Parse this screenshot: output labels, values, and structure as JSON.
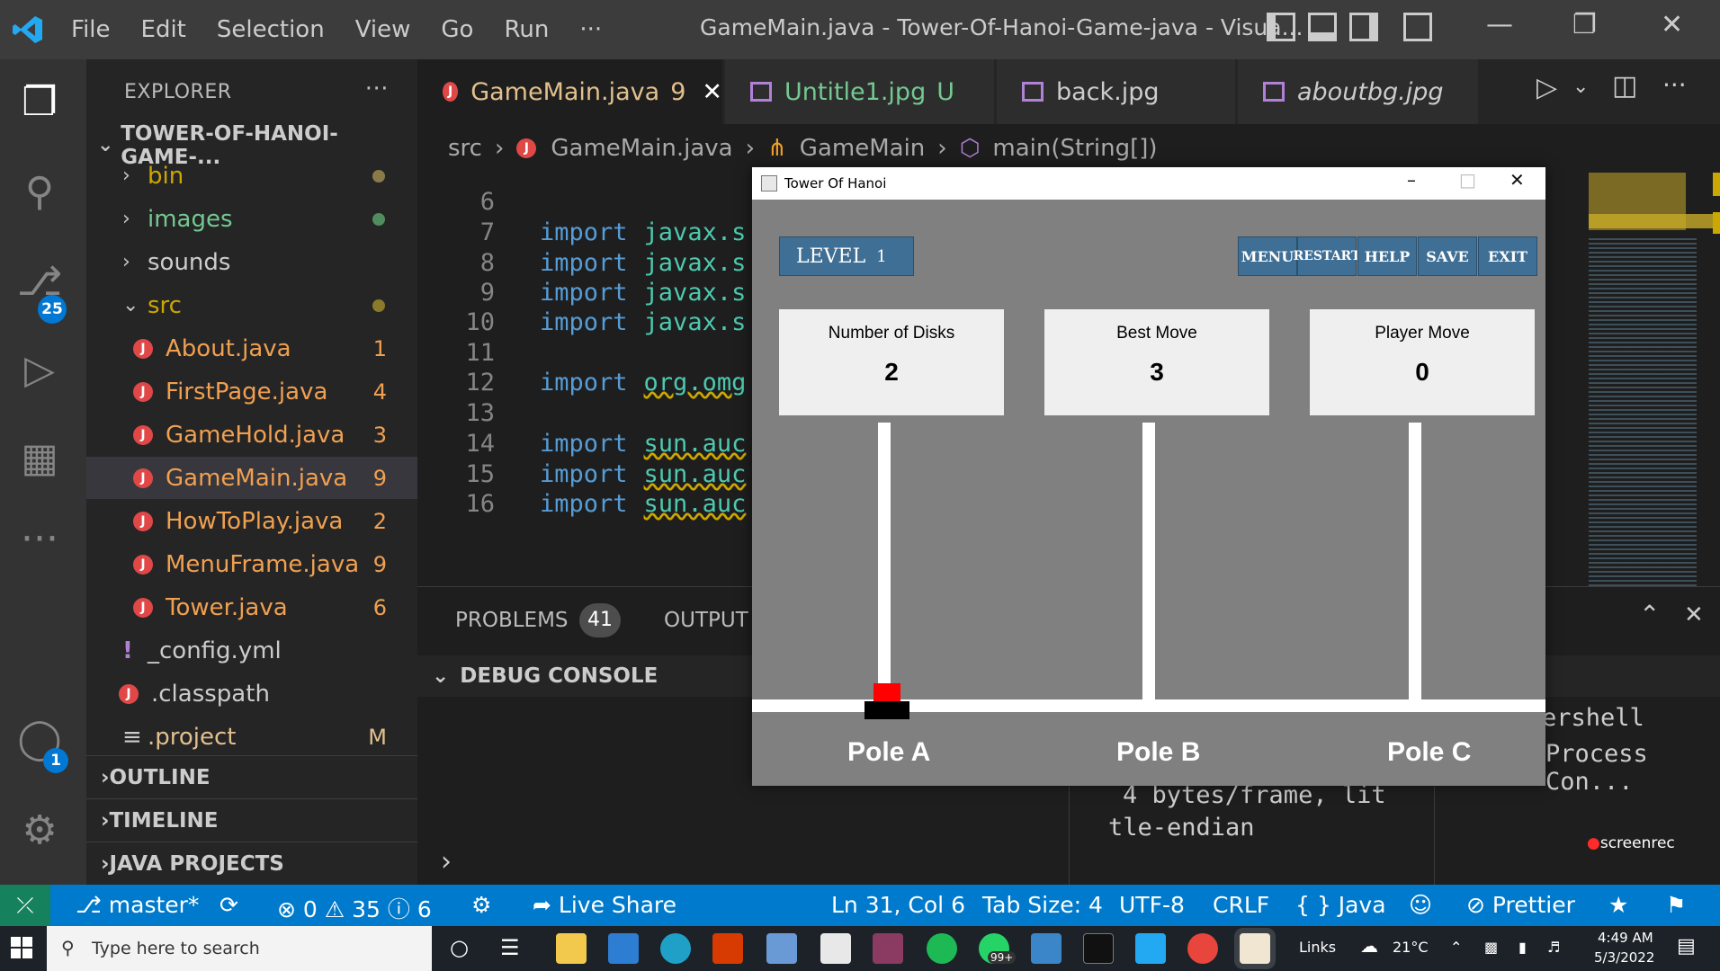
{
  "titlebar": {
    "menus": [
      "File",
      "Edit",
      "Selection",
      "View",
      "Go",
      "Run",
      "···"
    ],
    "window_title": "GameMain.java - Tower-Of-Hanoi-Game-java - Visua..."
  },
  "activitybar": {
    "scm_badge": "25",
    "accounts_badge": "1"
  },
  "sidebar": {
    "title": "EXPLORER",
    "project": "TOWER-OF-HANOI-GAME-...",
    "items": [
      {
        "label": "bin",
        "type": "folder"
      },
      {
        "label": "images",
        "type": "folder"
      },
      {
        "label": "sounds",
        "type": "folder"
      },
      {
        "label": "src",
        "type": "folder-open"
      },
      {
        "label": "About.java",
        "count": "1"
      },
      {
        "label": "FirstPage.java",
        "count": "4"
      },
      {
        "label": "GameHold.java",
        "count": "3"
      },
      {
        "label": "GameMain.java",
        "count": "9"
      },
      {
        "label": "HowToPlay.java",
        "count": "2"
      },
      {
        "label": "MenuFrame.java",
        "count": "9"
      },
      {
        "label": "Tower.java",
        "count": "6"
      },
      {
        "label": "_config.yml"
      },
      {
        "label": ".classpath"
      },
      {
        "label": ".project",
        "count": "M"
      }
    ],
    "sections": [
      "OUTLINE",
      "TIMELINE",
      "JAVA PROJECTS"
    ]
  },
  "tabs": [
    {
      "label": "GameMain.java",
      "badge": "9"
    },
    {
      "label": "Untitle1.jpg",
      "badge": "U"
    },
    {
      "label": "back.jpg"
    },
    {
      "label": "aboutbg.jpg"
    }
  ],
  "breadcrumb": [
    "src",
    "GameMain.java",
    "GameMain",
    "main(String[])"
  ],
  "code": [
    {
      "ln": "6",
      "kw": "",
      "pk": ""
    },
    {
      "ln": "7",
      "kw": "import",
      "pk": "javax.s"
    },
    {
      "ln": "8",
      "kw": "import",
      "pk": "javax.s"
    },
    {
      "ln": "9",
      "kw": "import",
      "pk": "javax.s"
    },
    {
      "ln": "10",
      "kw": "import",
      "pk": "javax.s"
    },
    {
      "ln": "11",
      "kw": "",
      "pk": ""
    },
    {
      "ln": "12",
      "kw": "import",
      "pk": "org.omg"
    },
    {
      "ln": "13",
      "kw": "",
      "pk": ""
    },
    {
      "ln": "14",
      "kw": "import",
      "pk": "sun.auc"
    },
    {
      "ln": "15",
      "kw": "import",
      "pk": "sun.auc"
    },
    {
      "ln": "16",
      "kw": "import",
      "pk": "sun.auc"
    }
  ],
  "panel": {
    "problems": "PROBLEMS",
    "problems_count": "41",
    "output": "OUTPUT",
    "debug_console": "DEBUG CONSOLE",
    "term_right_1": "ershell",
    "term_right_2": "Process Con...",
    "term_mid_1": "4 bytes/frame, lit",
    "term_mid_2": "tle-endian"
  },
  "statusbar": {
    "branch": "master*",
    "errors": "0",
    "warnings": "35",
    "infos": "6",
    "live_share": "Live Share",
    "position": "Ln 31, Col 6",
    "tab_size": "Tab Size: 4",
    "encoding": "UTF-8",
    "eol": "CRLF",
    "language": "Java",
    "prettier": "Prettier"
  },
  "taskbar": {
    "search_placeholder": "Type here to search",
    "links": "Links",
    "temperature": "21°C",
    "time": "4:49 AM",
    "date": "5/3/2022",
    "whatsapp_badge": "99+"
  },
  "game": {
    "title": "Tower Of Hanoi",
    "level_label": "LEVEL",
    "level": "1",
    "buttons": [
      "MENU",
      "RESTART",
      "HELP",
      "SAVE",
      "EXIT"
    ],
    "stats": [
      {
        "label": "Number of Disks",
        "value": "2"
      },
      {
        "label": "Best Move",
        "value": "3"
      },
      {
        "label": "Player Move",
        "value": "0"
      }
    ],
    "poles": [
      "Pole A",
      "Pole B",
      "Pole C"
    ],
    "disk_colors": [
      "#ff0000",
      "#000000"
    ]
  },
  "watermark": "screenrec"
}
